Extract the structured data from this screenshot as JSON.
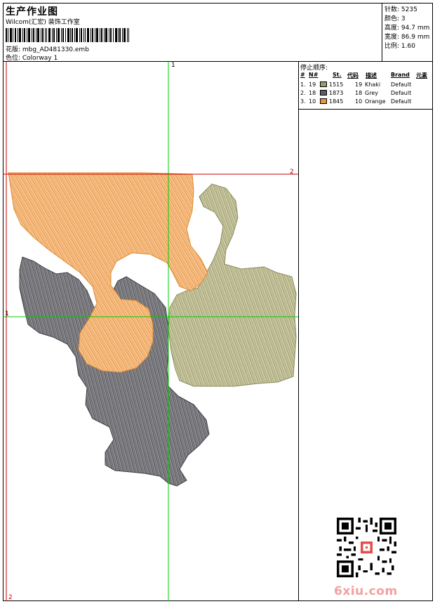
{
  "header": {
    "title": "生产作业图",
    "subtitle": "Wilcom(汇宏) 装饰工作室",
    "design_line": "花版: mbg_AD481330.emb",
    "colorway_line": "色位: Colorway 1"
  },
  "specs": [
    {
      "label": "针数",
      "value": "5235"
    },
    {
      "label": "颜色",
      "value": "3"
    },
    {
      "label": "高度",
      "value": "94.7 mm"
    },
    {
      "label": "宽度",
      "value": "86.9 mm"
    },
    {
      "label": "比例",
      "value": "1.60"
    }
  ],
  "stop_sequence": {
    "title": "停止顺序:",
    "headers": {
      "hash": "#",
      "n": "N#",
      "st": "St.",
      "code": "代码",
      "desc": "描述",
      "brand": "Brand",
      "elem": "元素"
    },
    "rows": [
      {
        "index": "1.",
        "n": "19",
        "st": "1515",
        "code": "19",
        "desc": "Khaki",
        "brand": "Default",
        "color": "#9b9a6c"
      },
      {
        "index": "2.",
        "n": "18",
        "st": "1873",
        "code": "18",
        "desc": "Grey",
        "brand": "Default",
        "color": "#5d5d63"
      },
      {
        "index": "3.",
        "n": "10",
        "st": "1845",
        "code": "10",
        "desc": "Orange",
        "brand": "Default",
        "color": "#e8953c"
      }
    ]
  },
  "axis_labels": {
    "top_vertical": "1",
    "right_horizontal": "2",
    "left_horizontal": "1",
    "bottom_vertical": "2"
  },
  "watermark": "6xiu.com",
  "colors": {
    "guide_green": "#00cc00",
    "guide_red": "#cc0000",
    "khaki": "#9b9a6c",
    "grey": "#5d5d63",
    "orange": "#e8953c"
  }
}
